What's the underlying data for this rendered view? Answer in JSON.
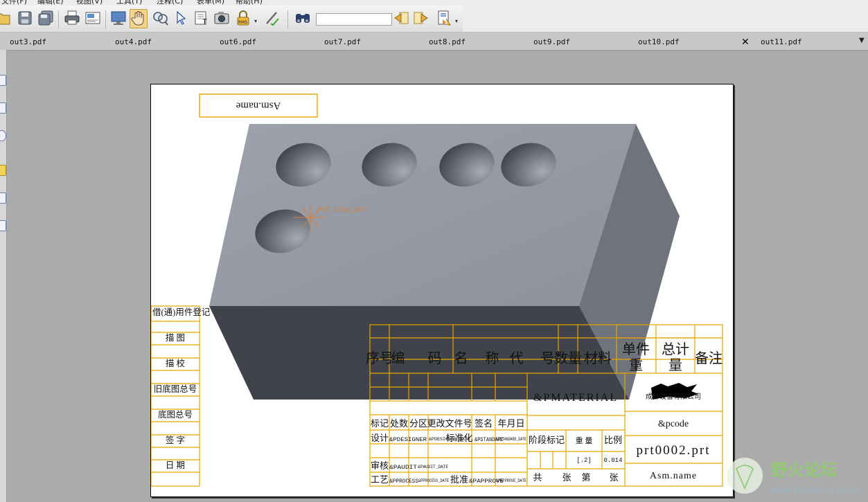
{
  "menu": {
    "items": [
      "文件(F)",
      "编辑(E)",
      "视图(V)",
      "工具(T)",
      "注释(C)",
      "表单(M)",
      "帮助(H)"
    ]
  },
  "toolbar": {
    "icons": [
      "open-icon",
      "save-icon",
      "save-all-icon",
      "print-icon",
      "page-setup-icon",
      "fullscreen-icon",
      "hand-tool-icon",
      "zoom-tool-icon",
      "select-tool-icon",
      "text-select-icon",
      "snapshot-icon",
      "rms-lock-icon",
      "sign-icon",
      "find-icon",
      "search-prev-icon",
      "search-next-icon",
      "highlight-icon"
    ],
    "rms_label": "RMS",
    "search_value": ""
  },
  "tabs": [
    {
      "label": "out3.pdf"
    },
    {
      "label": "out4.pdf"
    },
    {
      "label": "out6.pdf"
    },
    {
      "label": "out7.pdf"
    },
    {
      "label": "out8.pdf"
    },
    {
      "label": "out9.pdf"
    },
    {
      "label": "out10.pdf",
      "active": true
    },
    {
      "label": "out11.pdf"
    }
  ],
  "drawing": {
    "top_box": "Asm.name",
    "csys_label": "PRT_CSYS_DEF",
    "left_column": [
      "借(通)用件登记",
      "描 图",
      "描 校",
      "旧底图总号",
      "底图总号",
      "签 字",
      "日 期"
    ],
    "bom_header": {
      "seq": "序号",
      "code": "编 码",
      "name": "名 称",
      "dwg": "代 号",
      "qty": "数量",
      "material": "材料",
      "unit_weight_1": "单件",
      "unit_weight_2": "重",
      "total_1": "总计",
      "total_2": "量",
      "remark": "备注"
    },
    "material_field": "&PMATERIAL",
    "company": "成都设备有限公司",
    "revision_row": [
      "标记",
      "处数",
      "分区",
      "更改文件号",
      "签名",
      "年月日"
    ],
    "designer": {
      "label": "设计",
      "value": "&PDESIGNER",
      "date": "&PDESIGNER_DATE"
    },
    "standard": {
      "label": "标准化",
      "value": "&PSTANDARD",
      "date": "&PSTANDARD_DATE"
    },
    "checker": {
      "label": "审核",
      "value": "&PAUDIT",
      "date": "&PAUDIT_DATE"
    },
    "process": {
      "label": "工艺",
      "value": "&PPROCESS",
      "date": "&PPROCESS_DATE"
    },
    "approve": {
      "label": "批准",
      "value": "&PAPPROVE",
      "date": "&PAPPROVE_DATE"
    },
    "stage_mark": "阶段标记",
    "weight": "重 量",
    "scale": "比例",
    "weight_value": "[.2]",
    "scale_value": "0.014",
    "sheets": {
      "total": "共",
      "zhang1": "张",
      "di": "第",
      "zhang2": "张"
    },
    "pcode": "&pcode",
    "part_name": "prt0002.prt",
    "asm_name": "Asm.name"
  },
  "watermark": {
    "title": "野火论坛",
    "url": "www.proewildfire.cn"
  },
  "colors": {
    "frame": "#e6a500",
    "block_top": "#9a9ea8",
    "block_right": "#6e727a",
    "block_front": "#40434a",
    "csys": "#d4803a",
    "watermark": "#8fcf6a"
  }
}
